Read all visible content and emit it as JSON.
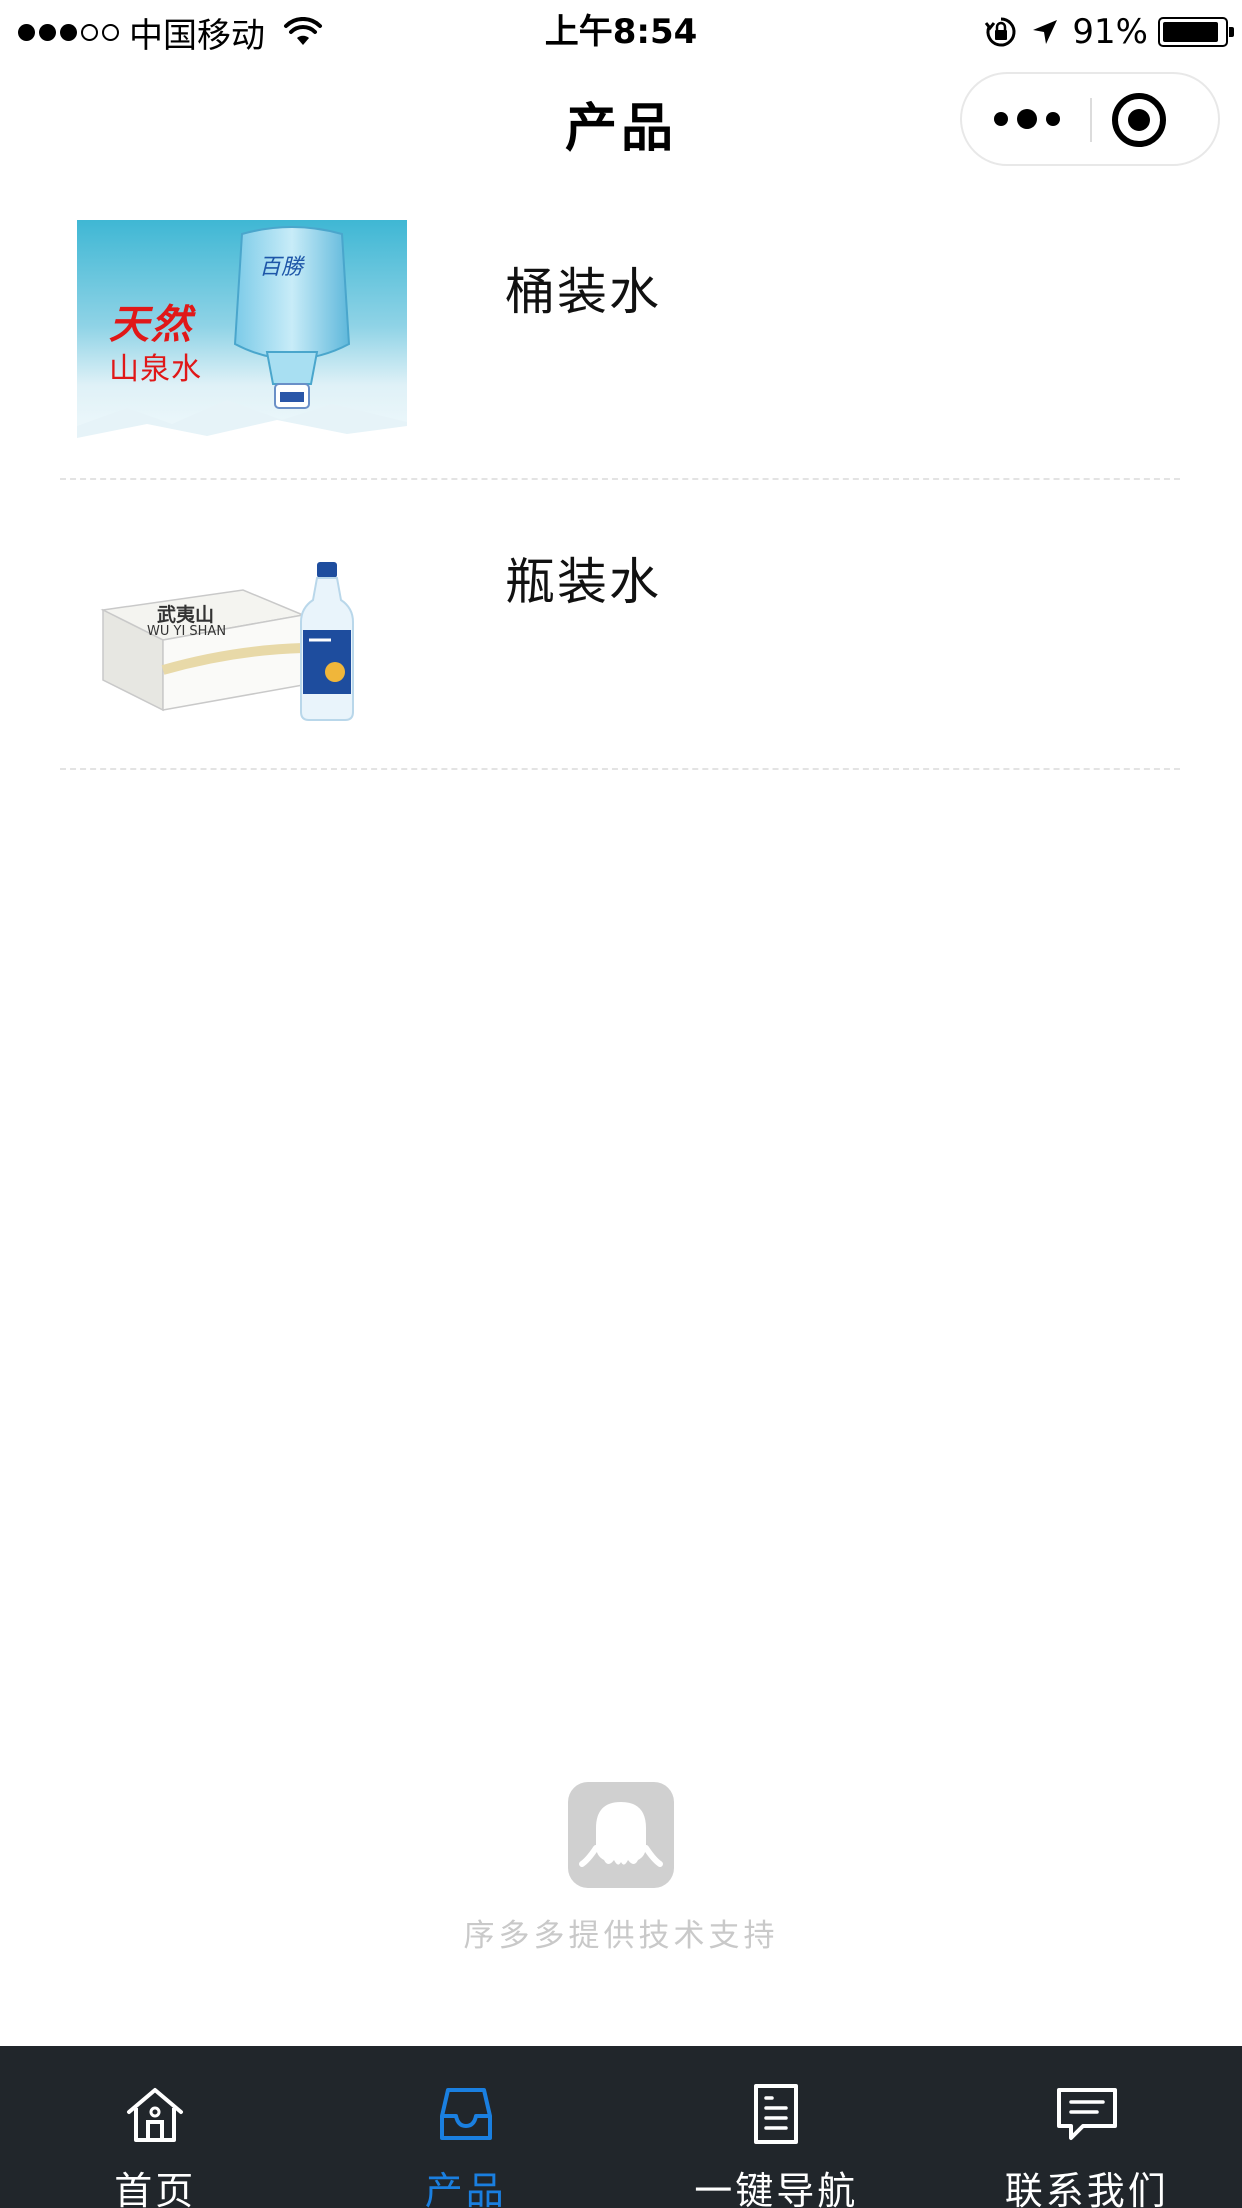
{
  "status_bar": {
    "carrier": "中国移动",
    "time": "上午8:54",
    "battery_percent": "91%",
    "battery_level": 0.91,
    "signal_bars_filled": 3,
    "signal_bars_total": 5
  },
  "nav": {
    "title": "产品"
  },
  "products": [
    {
      "name": "桶装水",
      "image": {
        "brand_line1": "天然",
        "brand_line2": "山泉水",
        "jug_logo": "百勝"
      }
    },
    {
      "name": "瓶装水",
      "image": {
        "brand": "武夷山",
        "brand_en": "WU YI SHAN"
      }
    }
  ],
  "support": {
    "text": "序多多提供技术支持"
  },
  "tabs": [
    {
      "label": "首页",
      "icon": "home-icon",
      "active": false
    },
    {
      "label": "产品",
      "icon": "tray-icon",
      "active": true
    },
    {
      "label": "一键导航",
      "icon": "document-icon",
      "active": false
    },
    {
      "label": "联系我们",
      "icon": "message-icon",
      "active": false
    }
  ],
  "colors": {
    "tab_bar_bg": "#21262b",
    "tab_active": "#1a7fe0",
    "tab_inactive": "#ffffff",
    "support_text": "#c9c9c9"
  }
}
